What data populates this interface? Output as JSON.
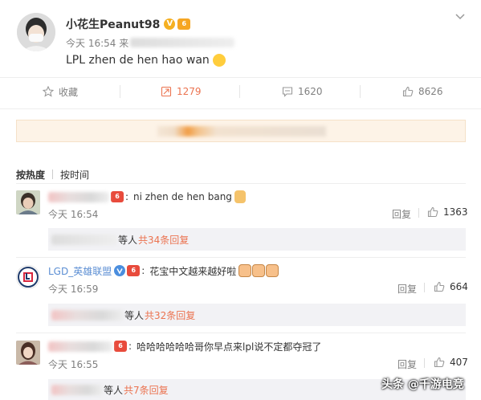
{
  "post": {
    "author": "小花生Peanut98",
    "time_prefix": "今天 16:54 来",
    "text": "LPL zhen de hen hao wan",
    "more_icon": "chevron-down-icon"
  },
  "actions": {
    "favorite_label": "收藏",
    "repost_count": "1279",
    "comment_count": "1620",
    "like_count": "8626"
  },
  "sort": {
    "hot": "按热度",
    "time": "按时间"
  },
  "comments": [
    {
      "text": "ni zhen de hen bang",
      "time": "今天 16:54",
      "reply_label": "回复",
      "like_count": "1363",
      "replies_suffix": "等人",
      "replies_link": "共34条回复"
    },
    {
      "author": "LGD_英雄联盟",
      "text": "花宝中文越来越好啦",
      "time": "今天 16:59",
      "reply_label": "回复",
      "like_count": "664",
      "replies_suffix": "等人",
      "replies_link": "共32条回复"
    },
    {
      "text": "哈哈哈哈哈哈哥你早点来lpl说不定都夺冠了",
      "time": "今天 16:55",
      "reply_label": "回复",
      "like_count": "407",
      "replies_suffix": "等人",
      "replies_link": "共7条回复"
    }
  ],
  "watermark": "头条 @千游电竞",
  "colors": {
    "accent_orange": "#eb7350",
    "link_blue": "#5b8ed3",
    "muted": "#808080",
    "reply_bg": "#f2f2f5",
    "notice_bg": "#fdf3e7"
  }
}
